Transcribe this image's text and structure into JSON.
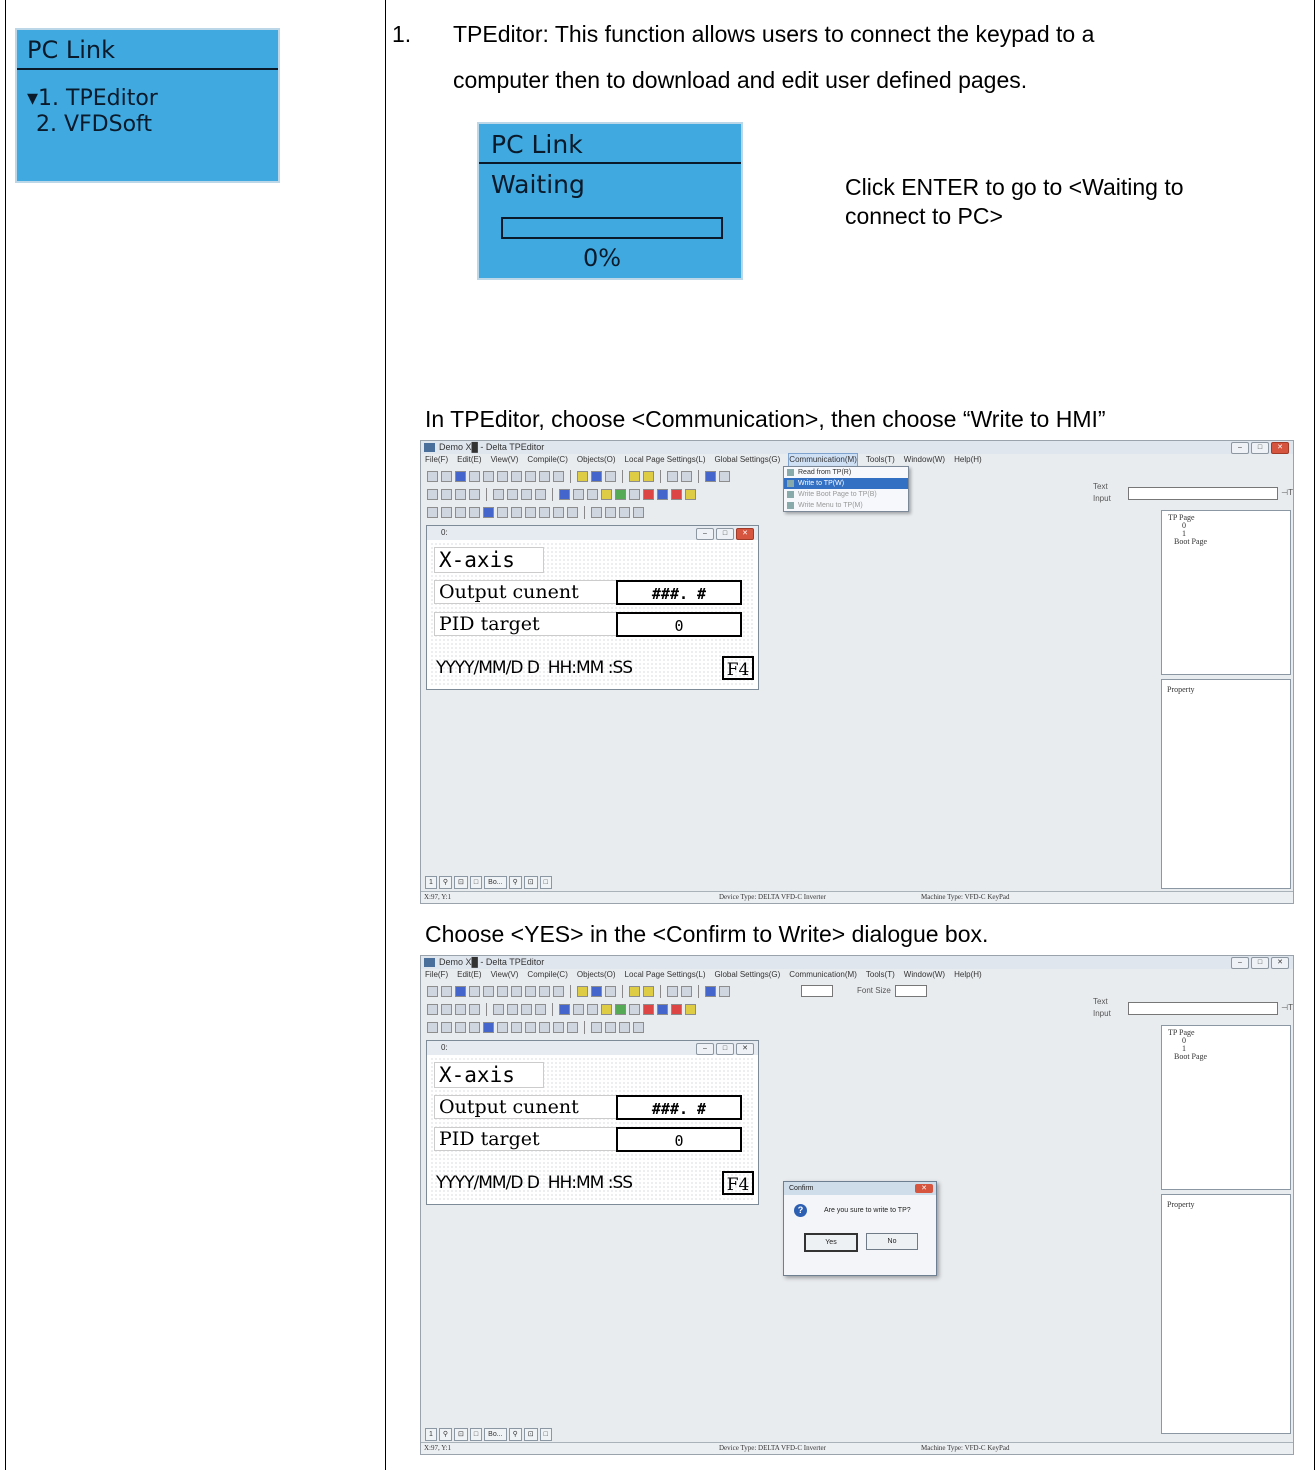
{
  "lcd_menu": {
    "title": "PC Link",
    "items": [
      "▾1. TPEditor",
      " 2. VFDSoft"
    ]
  },
  "step1": {
    "number": "1.",
    "text_line1": "TPEditor: This function allows users to connect the keypad to a",
    "text_line2": "computer then to download and edit user defined pages."
  },
  "lcd_waiting": {
    "title": "PC Link",
    "status": "Waiting",
    "percent": "0%",
    "progress": 0
  },
  "click_enter_text_1": "Click ENTER to go to <Waiting to",
  "click_enter_text_2": "connect to PC>",
  "instruction_write": "In TPEditor, choose <Communication>, then choose “Write to HMI”",
  "instruction_confirm": "Choose <YES> in the <Confirm to Write> dialogue box.",
  "app": {
    "title": "Demo X█ - Delta TPEditor",
    "menu": [
      "File(F)",
      "Edit(E)",
      "View(V)",
      "Compile(C)",
      "Objects(O)",
      "Local Page Settings(L)",
      "Global Settings(G)",
      "Communication(M)",
      "Tools(T)",
      "Window(W)",
      "Help(H)"
    ],
    "font_size_label": "Font Size",
    "text_input_label": "Text Input",
    "comm_menu": [
      "Read from TP(R)",
      "Write to TP(W)",
      "Write Boot Page to TP(B)",
      "Write Menu to TP(M)"
    ],
    "page_title": "0:",
    "page_content": {
      "heading": "X-axis",
      "row1_label": "Output cunent",
      "row1_value": "###. #",
      "row2_label": "PID target",
      "row2_value": "0",
      "datetime": "YYYY/MM/D D  HH:MM :SS",
      "fkey": "F4"
    },
    "tree": [
      "TP Page",
      "0",
      "1",
      "Boot Page"
    ],
    "property_label": "Property",
    "bottom_tabs": [
      "1",
      "Bo..."
    ],
    "status": {
      "coords": "X:97, Y:1",
      "device": "Device Type: DELTA VFD-C Inverter",
      "machine": "Machine Type: VFD-C KeyPad"
    }
  },
  "confirm_dialog": {
    "title": "Confirm",
    "message": "Are you sure to write to TP?",
    "yes": "Yes",
    "no": "No"
  }
}
